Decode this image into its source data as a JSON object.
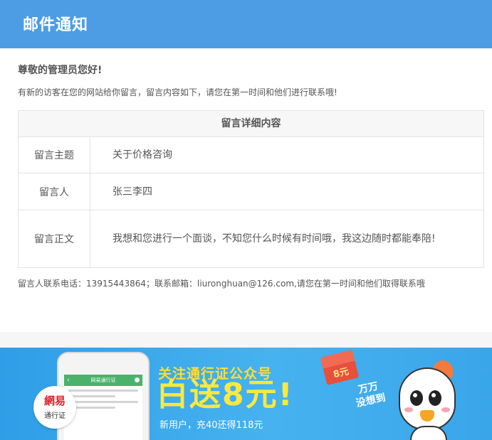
{
  "header": {
    "title": "邮件通知"
  },
  "body": {
    "greeting": "尊敬的管理员您好!",
    "intro": "有新的访客在您的网站给你留言，留言内容如下，请您在第一时间和他们进行联系哦!",
    "table": {
      "heading": "留言详细内容",
      "rows": [
        {
          "key": "留言主题",
          "value": "关于价格咨询"
        },
        {
          "key": "留言人",
          "value": "张三李四"
        },
        {
          "key": "留言正文",
          "value": "我想和您进行一个面谈，不知您什么时候有时间哦，我这边随时都能奉陪!"
        }
      ]
    },
    "contact": "留言人联系电话：13915443864；联系邮箱：liuronghuan@126.com,请您在第一时间和他们取得联系哦"
  },
  "banner": {
    "logo_top": "網易",
    "logo_bottom": "通行证",
    "phone_title": "网易通行证",
    "title": "关注通行证公众号",
    "big_text": "白送8元!",
    "subtitle": "新用户，充40还得118元",
    "envelope_label": "8元",
    "slogan_line1": "万万",
    "slogan_line2": "没想到",
    "colors": {
      "header": "#4c9de4",
      "banner": "#3aa6ea",
      "highlight": "#ffe93a"
    }
  }
}
